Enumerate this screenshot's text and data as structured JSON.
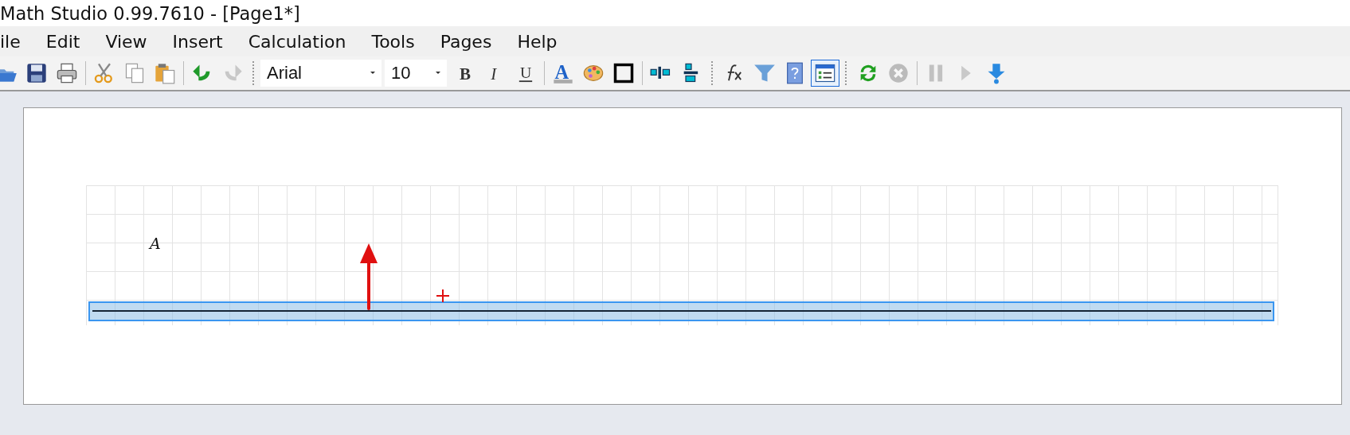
{
  "window": {
    "title": "Math Studio 0.99.7610 - [Page1*]"
  },
  "menu": [
    "ile",
    "Edit",
    "View",
    "Insert",
    "Calculation",
    "Tools",
    "Pages",
    "Help"
  ],
  "toolbar": [
    {
      "kind": "open",
      "disabled": false,
      "pressed": false
    },
    {
      "kind": "save",
      "disabled": false,
      "pressed": false
    },
    {
      "kind": "print",
      "disabled": false,
      "pressed": false
    },
    {
      "kind": "separator"
    },
    {
      "kind": "cut",
      "disabled": false,
      "pressed": false
    },
    {
      "kind": "copy",
      "disabled": false,
      "pressed": false
    },
    {
      "kind": "paste",
      "disabled": false,
      "pressed": false
    },
    {
      "kind": "separator"
    },
    {
      "kind": "undo",
      "disabled": false,
      "pressed": false
    },
    {
      "kind": "redo",
      "disabled": true,
      "pressed": false
    },
    {
      "kind": "grip"
    },
    {
      "kind": "font",
      "value": "Arial"
    },
    {
      "kind": "size",
      "value": "10"
    },
    {
      "kind": "bold",
      "glyph": "B",
      "disabled": false,
      "pressed": false
    },
    {
      "kind": "italic",
      "glyph": "I",
      "disabled": false,
      "pressed": false
    },
    {
      "kind": "underline",
      "glyph": "U",
      "disabled": false,
      "pressed": false
    },
    {
      "kind": "separator"
    },
    {
      "kind": "textcolor",
      "glyph": "A",
      "disabled": false,
      "pressed": false
    },
    {
      "kind": "palette",
      "disabled": false,
      "pressed": false
    },
    {
      "kind": "border",
      "disabled": false,
      "pressed": false
    },
    {
      "kind": "separator"
    },
    {
      "kind": "alignh",
      "disabled": false,
      "pressed": false
    },
    {
      "kind": "alignv",
      "disabled": false,
      "pressed": false
    },
    {
      "kind": "grip"
    },
    {
      "kind": "function",
      "disabled": false,
      "pressed": false
    },
    {
      "kind": "filter",
      "disabled": false,
      "pressed": false
    },
    {
      "kind": "help",
      "disabled": false,
      "pressed": false
    },
    {
      "kind": "list",
      "disabled": false,
      "pressed": true
    },
    {
      "kind": "grip"
    },
    {
      "kind": "refresh",
      "disabled": false,
      "pressed": false
    },
    {
      "kind": "stop",
      "disabled": true,
      "pressed": false
    },
    {
      "kind": "separator"
    },
    {
      "kind": "pause",
      "disabled": true,
      "pressed": false
    },
    {
      "kind": "play",
      "disabled": true,
      "pressed": false
    },
    {
      "kind": "step",
      "disabled": false,
      "pressed": false
    }
  ],
  "canvas": {
    "label": "A"
  }
}
